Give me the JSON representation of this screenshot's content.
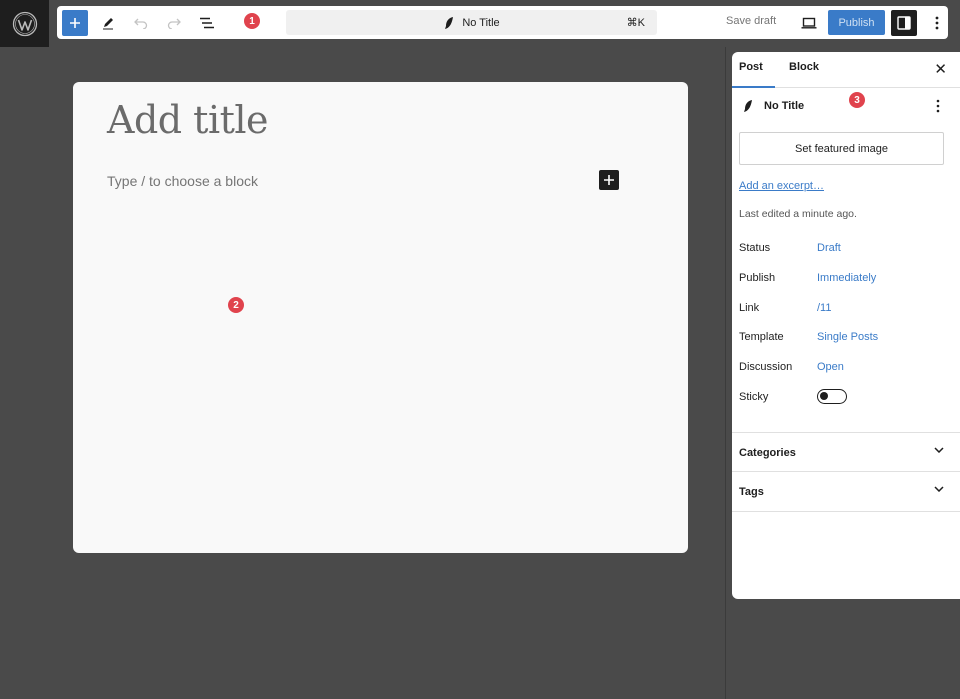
{
  "colors": {
    "accent": "#3a7bc8",
    "badge": "#e0434d",
    "dark": "#1e1e1e",
    "backdrop": "#4a4a4a"
  },
  "toolbar": {
    "inserter_icon": "plus-icon",
    "tools_icon": "pencil-icon",
    "undo_icon": "undo-icon",
    "redo_icon": "redo-icon",
    "outline_icon": "list-view-icon",
    "command_title": "No Title",
    "command_shortcut": "⌘K",
    "save_draft": "Save draft",
    "publish": "Publish"
  },
  "badges": {
    "one": "1",
    "two": "2",
    "three": "3"
  },
  "canvas": {
    "title_placeholder": "Add title",
    "block_placeholder": "Type / to choose a block"
  },
  "sidebar": {
    "tabs": {
      "post": "Post",
      "block": "Block"
    },
    "close": "✕",
    "doc_title": "No Title",
    "featured_image": "Set featured image",
    "excerpt": "Add an excerpt…",
    "last_edited": "Last edited a minute ago.",
    "meta": {
      "status_label": "Status",
      "status_value": "Draft",
      "publish_label": "Publish",
      "publish_value": "Immediately",
      "link_label": "Link",
      "link_value": "/11",
      "template_label": "Template",
      "template_value": "Single Posts",
      "discussion_label": "Discussion",
      "discussion_value": "Open",
      "sticky_label": "Sticky",
      "sticky_on": false
    },
    "panels": {
      "categories": "Categories",
      "tags": "Tags"
    }
  }
}
